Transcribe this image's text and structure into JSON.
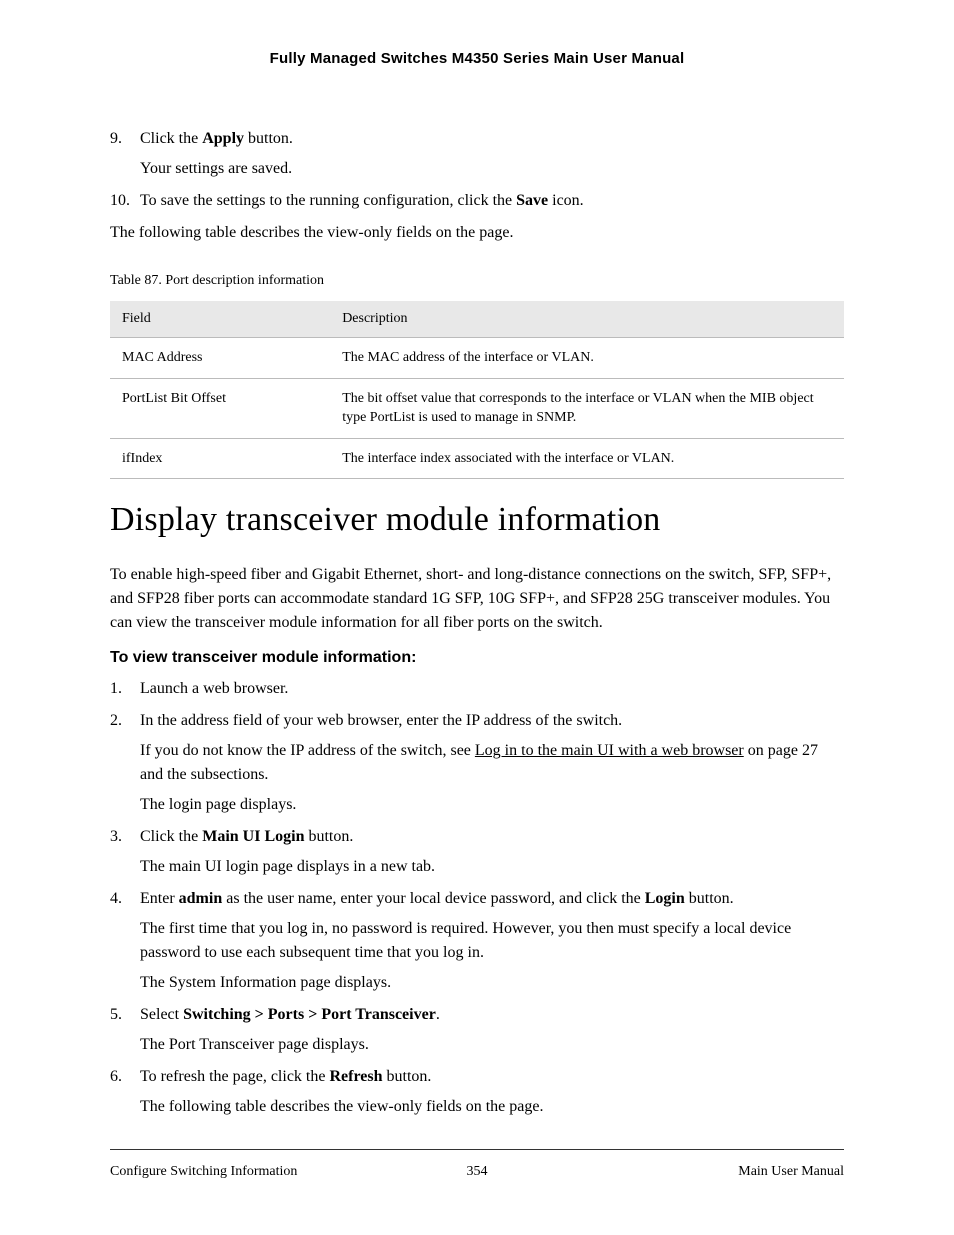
{
  "header": {
    "title": "Fully Managed Switches M4350 Series Main User Manual"
  },
  "topSteps": {
    "step9": {
      "num": "9.",
      "text_pre": "Click the ",
      "text_bold": "Apply",
      "text_post": " button.",
      "sub": "Your settings are saved."
    },
    "step10": {
      "num": "10.",
      "text_pre": "To save the settings to the running configuration, click the ",
      "text_bold": "Save",
      "text_post": " icon."
    }
  },
  "intro_line": "The following table describes the view-only fields on the page.",
  "table": {
    "caption": "Table 87. Port description information",
    "headers": {
      "col1": "Field",
      "col2": "Description"
    },
    "rows": [
      {
        "field": "MAC Address",
        "desc": "The MAC address of the interface or VLAN."
      },
      {
        "field": "PortList Bit Offset",
        "desc": "The bit offset value that corresponds to the interface or VLAN when the MIB object type PortList is used to manage in SNMP."
      },
      {
        "field": "ifIndex",
        "desc": "The interface index associated with the interface or VLAN."
      }
    ]
  },
  "section": {
    "heading": "Display transceiver module information",
    "para": "To enable high-speed fiber and Gigabit Ethernet, short- and long-distance connections on the switch, SFP, SFP+, and SFP28 fiber ports can accommodate standard 1G SFP, 10G SFP+, and SFP28 25G transceiver modules. You can view the transceiver module information for all fiber ports on the switch.",
    "subheading": "To view transceiver module information:"
  },
  "steps": {
    "s1": {
      "num": "1.",
      "text": "Launch a web browser."
    },
    "s2": {
      "num": "2.",
      "text": "In the address field of your web browser, enter the IP address of the switch.",
      "sub1_pre": "If you do not know the IP address of the switch, see ",
      "sub1_link": "Log in to the main UI with a web browser",
      "sub1_post": " on page 27 and the subsections.",
      "sub2": "The login page displays."
    },
    "s3": {
      "num": "3.",
      "text_pre": "Click the ",
      "text_bold": "Main UI Login",
      "text_post": " button.",
      "sub": "The main UI login page displays in a new tab."
    },
    "s4": {
      "num": "4.",
      "text_pre": "Enter ",
      "text_bold1": "admin",
      "text_mid": " as the user name, enter your local device password, and click the ",
      "text_bold2": "Login",
      "text_post": " button.",
      "sub1": "The first time that you log in, no password is required. However, you then must specify a local device password to use each subsequent time that you log in.",
      "sub2": "The System Information page displays."
    },
    "s5": {
      "num": "5.",
      "text_pre": "Select ",
      "text_bold": "Switching > Ports > Port Transceiver",
      "text_post": ".",
      "sub": "The Port Transceiver page displays."
    },
    "s6": {
      "num": "6.",
      "text_pre": "To refresh the page, click the ",
      "text_bold": "Refresh",
      "text_post": " button.",
      "sub": "The following table describes the view-only fields on the page."
    }
  },
  "footer": {
    "left": "Configure Switching Information",
    "center": "354",
    "right": "Main User Manual"
  }
}
